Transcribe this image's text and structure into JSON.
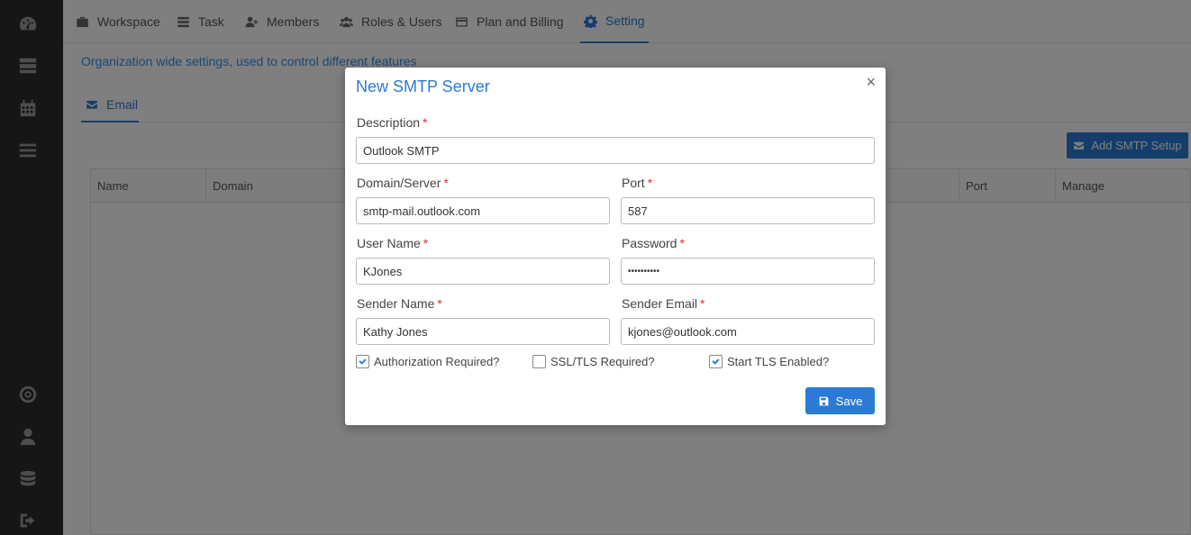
{
  "sidebar": {
    "items": [
      {
        "icon": "dashboard-gauge-icon"
      },
      {
        "icon": "server-icon"
      },
      {
        "icon": "calendar-icon"
      },
      {
        "icon": "menu-list-icon"
      },
      {
        "icon": "target-icon"
      },
      {
        "icon": "user-icon"
      },
      {
        "icon": "database-icon"
      },
      {
        "icon": "sign-out-icon"
      }
    ]
  },
  "tabs": [
    {
      "label": "Workspace",
      "icon": "briefcase-icon"
    },
    {
      "label": "Task",
      "icon": "list-icon"
    },
    {
      "label": "Members",
      "icon": "user-plus-icon"
    },
    {
      "label": "Roles & Users",
      "icon": "users-icon"
    },
    {
      "label": "Plan and Billing",
      "icon": "credit-card-icon"
    },
    {
      "label": "Setting",
      "icon": "gear-icon",
      "active": true
    }
  ],
  "subtitle": "Organization wide settings, used to control different features",
  "subtabs": [
    {
      "label": "Email",
      "icon": "envelope-icon",
      "active": true
    }
  ],
  "add_button": "Add SMTP Setup",
  "table": {
    "headers": [
      "Name",
      "Domain",
      "Port",
      "Manage"
    ]
  },
  "modal": {
    "title": "New SMTP Server",
    "close": "×",
    "fields": {
      "description": {
        "label": "Description",
        "value": "Outlook SMTP"
      },
      "domain": {
        "label": "Domain/Server",
        "value": "smtp-mail.outlook.com"
      },
      "port": {
        "label": "Port",
        "value": "587"
      },
      "username": {
        "label": "User Name",
        "value": "KJones"
      },
      "password": {
        "label": "Password",
        "value": "••••••••••"
      },
      "sender_name": {
        "label": "Sender Name",
        "value": "Kathy Jones"
      },
      "sender_email": {
        "label": "Sender Email",
        "value": "kjones@outlook.com"
      }
    },
    "required_mark": "*",
    "checkboxes": [
      {
        "label": "Authorization Required?",
        "checked": true
      },
      {
        "label": "SSL/TLS Required?",
        "checked": false
      },
      {
        "label": "Start TLS Enabled?",
        "checked": true
      }
    ],
    "save": "Save"
  },
  "colors": {
    "accent": "#2b7bd6",
    "sidebar": "#2d2d2d",
    "required": "#e03030"
  }
}
